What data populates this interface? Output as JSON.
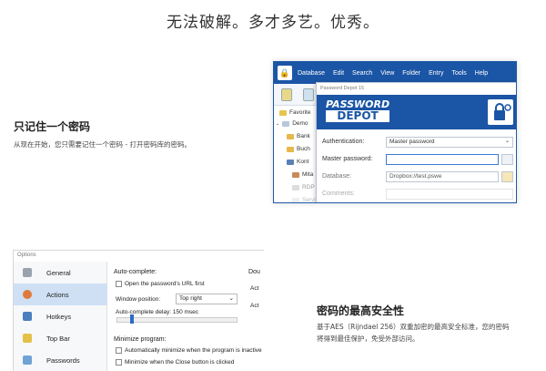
{
  "hero": {
    "title": "无法破解。多才多艺。优秀。"
  },
  "section1": {
    "title": "只记住一个密码",
    "text": "从现在开始，您只需要记住一个密码 - 打开密码库的密码。"
  },
  "section2": {
    "title": "密码的最高安全性",
    "text_line1": "基于AES（Rijndael 256）双重加密的最高安全标准，您的密码",
    "text_line2": "将得到最佳保护，免受外部访问。"
  },
  "pd_window": {
    "menu": [
      "Database",
      "Edit",
      "Search",
      "View",
      "Folder",
      "Entry",
      "Tools",
      "Help"
    ],
    "tree": [
      "Favorite",
      "Demo",
      "Bank",
      "Buch",
      "Kont",
      "Mita",
      "RDP",
      "Servi"
    ],
    "dialog": {
      "title": "Password Depot 15",
      "logo_line1": "PASSWORD",
      "logo_line2": "DEPOT",
      "auth_label": "Authentication:",
      "auth_value": "Master password",
      "master_label": "Master password:",
      "master_value": "",
      "db_label": "Database:",
      "db_value": "Dropbox://test.pswe",
      "comments_label": "Comments:"
    }
  },
  "options_window": {
    "title": "Options",
    "nav": [
      "General",
      "Actions",
      "Hotkeys",
      "Top Bar",
      "Passwords"
    ],
    "active_nav": "Actions",
    "autocomplete": {
      "header": "Auto-complete:",
      "open_url": "Open the password's URL first",
      "window_pos_label": "Window position:",
      "window_pos_value": "Top right",
      "delay_label": "Auto-complete delay: 150 msec"
    },
    "right_col": {
      "header": "Dou",
      "a1": "Act",
      "a2": "Act"
    },
    "minimize": {
      "header": "Minimize program:",
      "opt1": "Automatically minimize when the program is inactive",
      "opt2": "Minimize when the Close button is clicked"
    }
  },
  "colors": {
    "brand_blue": "#1b55a5",
    "nav_active": "#cfe0f5"
  }
}
